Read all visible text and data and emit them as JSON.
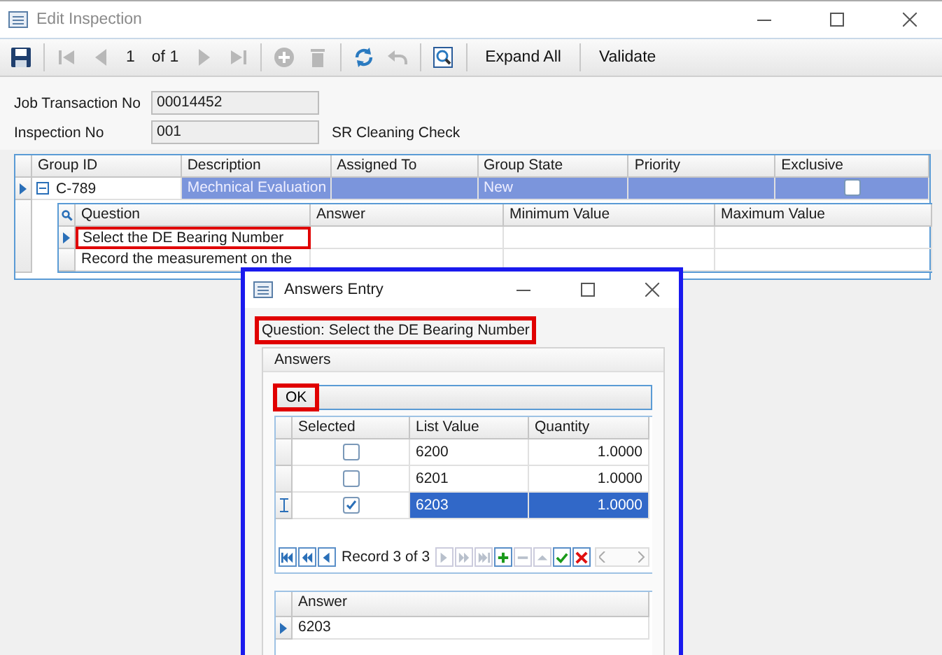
{
  "window": {
    "title": "Edit Inspection"
  },
  "toolbar": [
    {
      "kind": "save",
      "disabled": false
    },
    {
      "kind": "separator"
    },
    {
      "kind": "first",
      "disabled": true
    },
    {
      "kind": "prev",
      "disabled": true
    },
    {
      "kind": "text",
      "label": "1"
    },
    {
      "kind": "text",
      "label": "of 1"
    },
    {
      "kind": "next",
      "disabled": true
    },
    {
      "kind": "last",
      "disabled": true
    },
    {
      "kind": "separator"
    },
    {
      "kind": "add",
      "disabled": true
    },
    {
      "kind": "delete",
      "disabled": true
    },
    {
      "kind": "separator"
    },
    {
      "kind": "refresh",
      "disabled": false
    },
    {
      "kind": "undo",
      "disabled": true
    },
    {
      "kind": "separator"
    },
    {
      "kind": "preview",
      "disabled": false
    },
    {
      "kind": "separator"
    },
    {
      "kind": "button",
      "label": "Expand All"
    },
    {
      "kind": "separator"
    },
    {
      "kind": "button",
      "label": "Validate"
    }
  ],
  "fields": [
    {
      "label": "Job Transaction No",
      "value": "00014452"
    },
    {
      "label": "Inspection No",
      "value": "001",
      "note": "SR Cleaning Check"
    }
  ],
  "groups": {
    "columns": [
      "Group ID",
      "Description",
      "Assigned To",
      "Group State",
      "Priority",
      "Exclusive"
    ],
    "rows": [
      {
        "group_id": "C-789",
        "description": "Mechnical Evaluation",
        "assigned_to": "",
        "group_state": "New",
        "priority": "",
        "exclusive": false,
        "expanded": true,
        "selected": true
      }
    ],
    "questions": {
      "columns": [
        "Question",
        "Answer",
        "Minimum Value",
        "Maximum Value"
      ],
      "rows": [
        {
          "question": "Select the DE Bearing Number",
          "current": true,
          "highlighted": true
        },
        {
          "question": "Record the measurement on the",
          "current": false,
          "highlighted": false
        }
      ]
    }
  },
  "dialog": {
    "title": "Answers Entry",
    "question": "Question: Select the DE Bearing Number",
    "question_highlighted": true,
    "group_title": "Answers",
    "ok": "OK",
    "ok_highlighted": true,
    "columns": [
      "Selected",
      "List Value",
      "Quantity"
    ],
    "rows": [
      {
        "checked": false,
        "value": "6200",
        "quantity": "1.0000",
        "selected": false
      },
      {
        "checked": false,
        "value": "6201",
        "quantity": "1.0000",
        "selected": false
      },
      {
        "checked": true,
        "value": "6203",
        "quantity": "1.0000",
        "selected": true
      }
    ],
    "navigator": {
      "record": "Record 3 of 3",
      "buttons": [
        {
          "kind": "first",
          "disabled": false
        },
        {
          "kind": "prevpage",
          "disabled": false
        },
        {
          "kind": "prev",
          "disabled": false
        },
        {
          "kind": "record"
        },
        {
          "kind": "next",
          "disabled": true
        },
        {
          "kind": "nextpage",
          "disabled": true
        },
        {
          "kind": "last",
          "disabled": true
        },
        {
          "kind": "add",
          "disabled": false
        },
        {
          "kind": "remove",
          "disabled": true
        },
        {
          "kind": "up",
          "disabled": true
        },
        {
          "kind": "confirm",
          "disabled": false
        },
        {
          "kind": "cancel",
          "disabled": false
        }
      ]
    },
    "answer_columns": [
      "Answer"
    ],
    "answers": [
      "6203"
    ]
  }
}
